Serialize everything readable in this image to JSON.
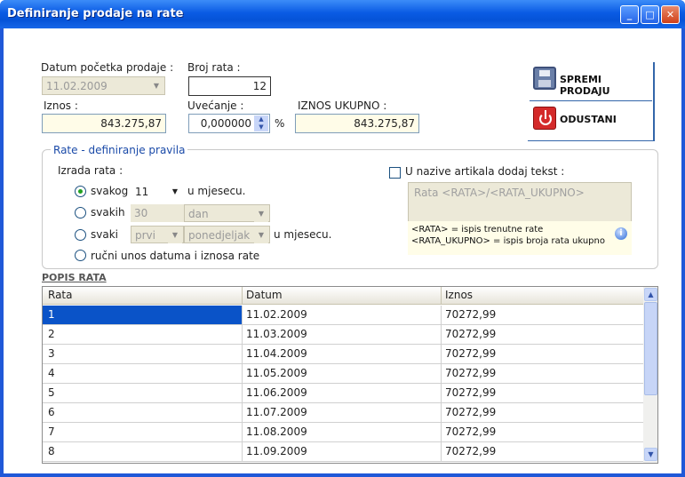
{
  "window": {
    "title": "Definiranje prodaje na rate"
  },
  "form": {
    "datum_label": "Datum početka prodaje :",
    "datum_value": "11.02.2009",
    "broj_label": "Broj rata :",
    "broj_value": "12",
    "iznos_label": "Iznos :",
    "iznos_value": "843.275,87",
    "uvecanje_label": "Uvećanje  :",
    "uvecanje_value": "0,000000",
    "percent": "%",
    "ukupno_label": "IZNOS UKUPNO :",
    "ukupno_value": "843.275,87"
  },
  "buttons": {
    "save": "SPREMI PRODAJU",
    "cancel": "ODUSTANI"
  },
  "group": {
    "title": "Rate - definiranje pravila",
    "izrada": "Izrada rata :",
    "r1": "svakog",
    "r1_value": "11",
    "r1_suffix": "u mjesecu.",
    "r2": "svakih",
    "r2_value": "30",
    "r2_unit": "dan",
    "r3": "svaki",
    "r3_which": "prvi",
    "r3_day": "ponedjeljak",
    "r3_suffix": "u mjesecu.",
    "r4": "ručni unos datuma i iznosa rate",
    "check_label": "U nazive artikala dodaj tekst :",
    "template": "Rata <RATA>/<RATA_UKUPNO>",
    "tip1": "<RATA> = ispis trenutne rate",
    "tip2": "<RATA_UKUPNO> = ispis broja rata ukupno"
  },
  "table": {
    "title": "POPIS RATA",
    "columns": [
      "Rata",
      "Datum",
      "Iznos"
    ],
    "rows": [
      [
        "1",
        "11.02.2009",
        "70272,99"
      ],
      [
        "2",
        "11.03.2009",
        "70272,99"
      ],
      [
        "3",
        "11.04.2009",
        "70272,99"
      ],
      [
        "4",
        "11.05.2009",
        "70272,99"
      ],
      [
        "5",
        "11.06.2009",
        "70272,99"
      ],
      [
        "6",
        "11.07.2009",
        "70272,99"
      ],
      [
        "7",
        "11.08.2009",
        "70272,99"
      ],
      [
        "8",
        "11.09.2009",
        "70272,99"
      ]
    ]
  },
  "colors": {
    "accent": "#1a4aa8",
    "selected_row": "#0a53c8"
  }
}
